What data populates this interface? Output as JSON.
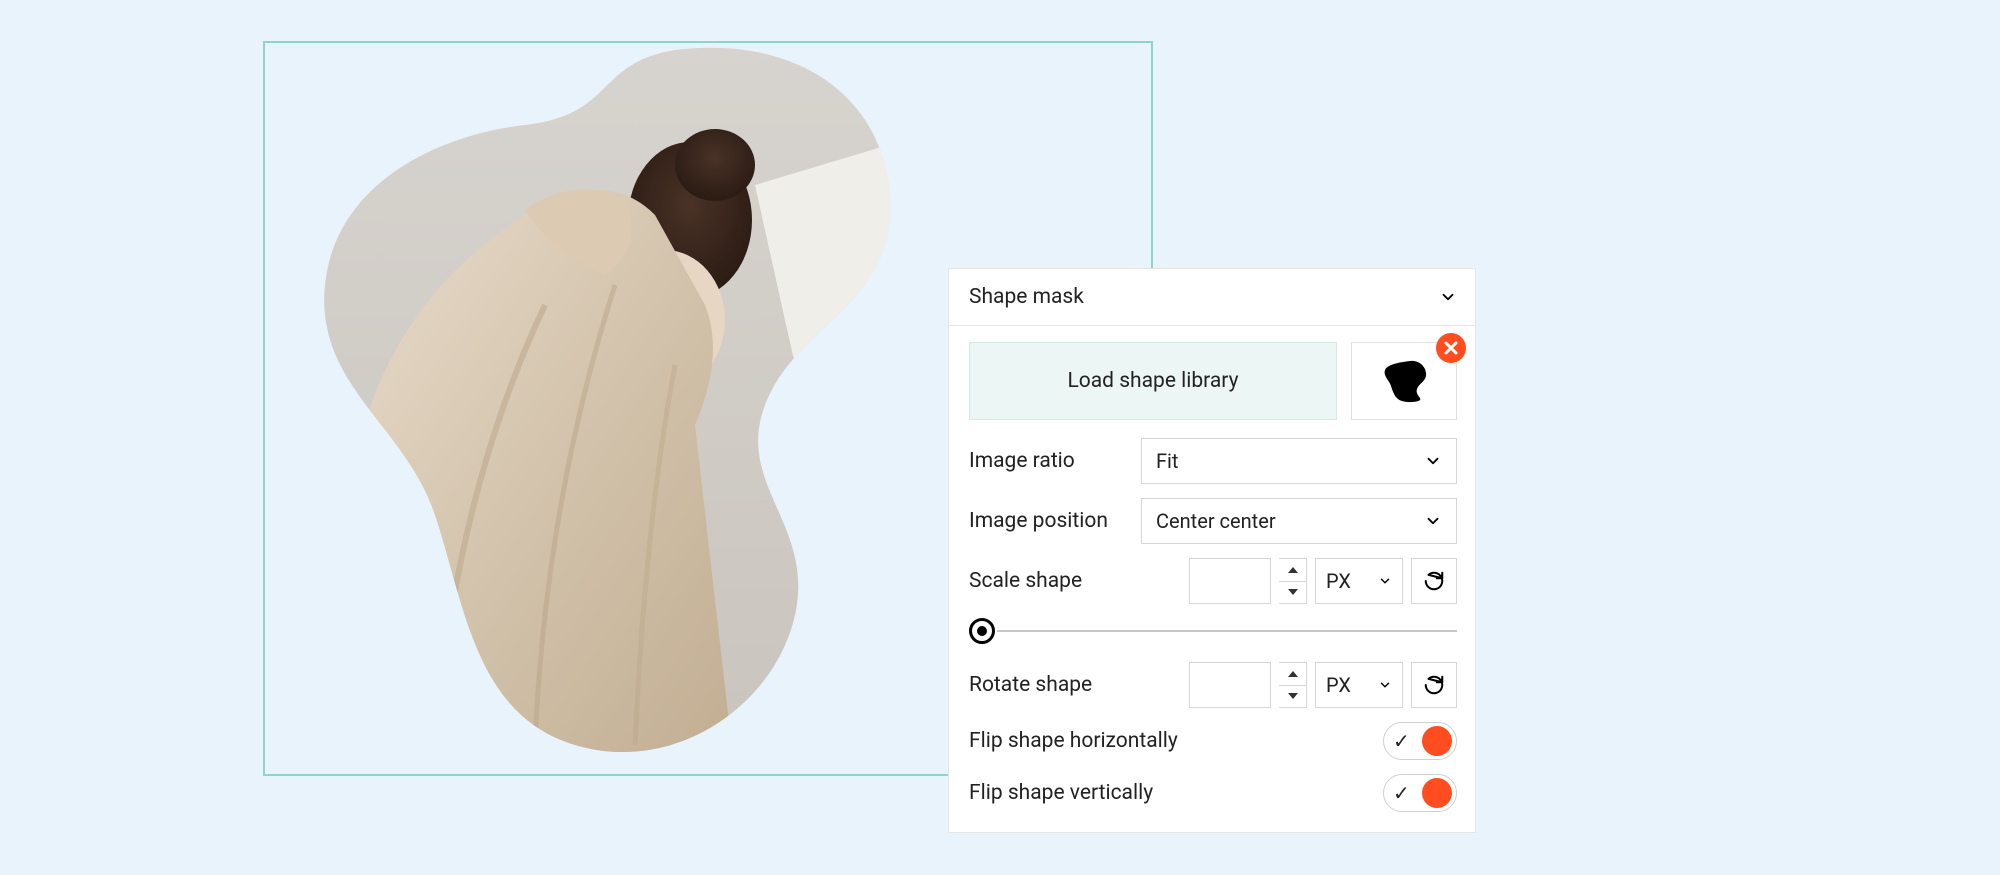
{
  "panel": {
    "title": "Shape mask",
    "load_button": "Load shape library",
    "image_ratio": {
      "label": "Image ratio",
      "value": "Fit"
    },
    "image_position": {
      "label": "Image position",
      "value": "Center center"
    },
    "scale": {
      "label": "Scale shape",
      "value": "",
      "unit": "PX"
    },
    "rotate": {
      "label": "Rotate shape",
      "value": "",
      "unit": "PX"
    },
    "flip_h": {
      "label": "Flip shape horizontally",
      "on": true
    },
    "flip_v": {
      "label": "Flip shape vertically",
      "on": true
    }
  },
  "colors": {
    "accent": "#ff4d1f",
    "frame": "#8fd4c5",
    "bg": "#e8f3fb"
  }
}
